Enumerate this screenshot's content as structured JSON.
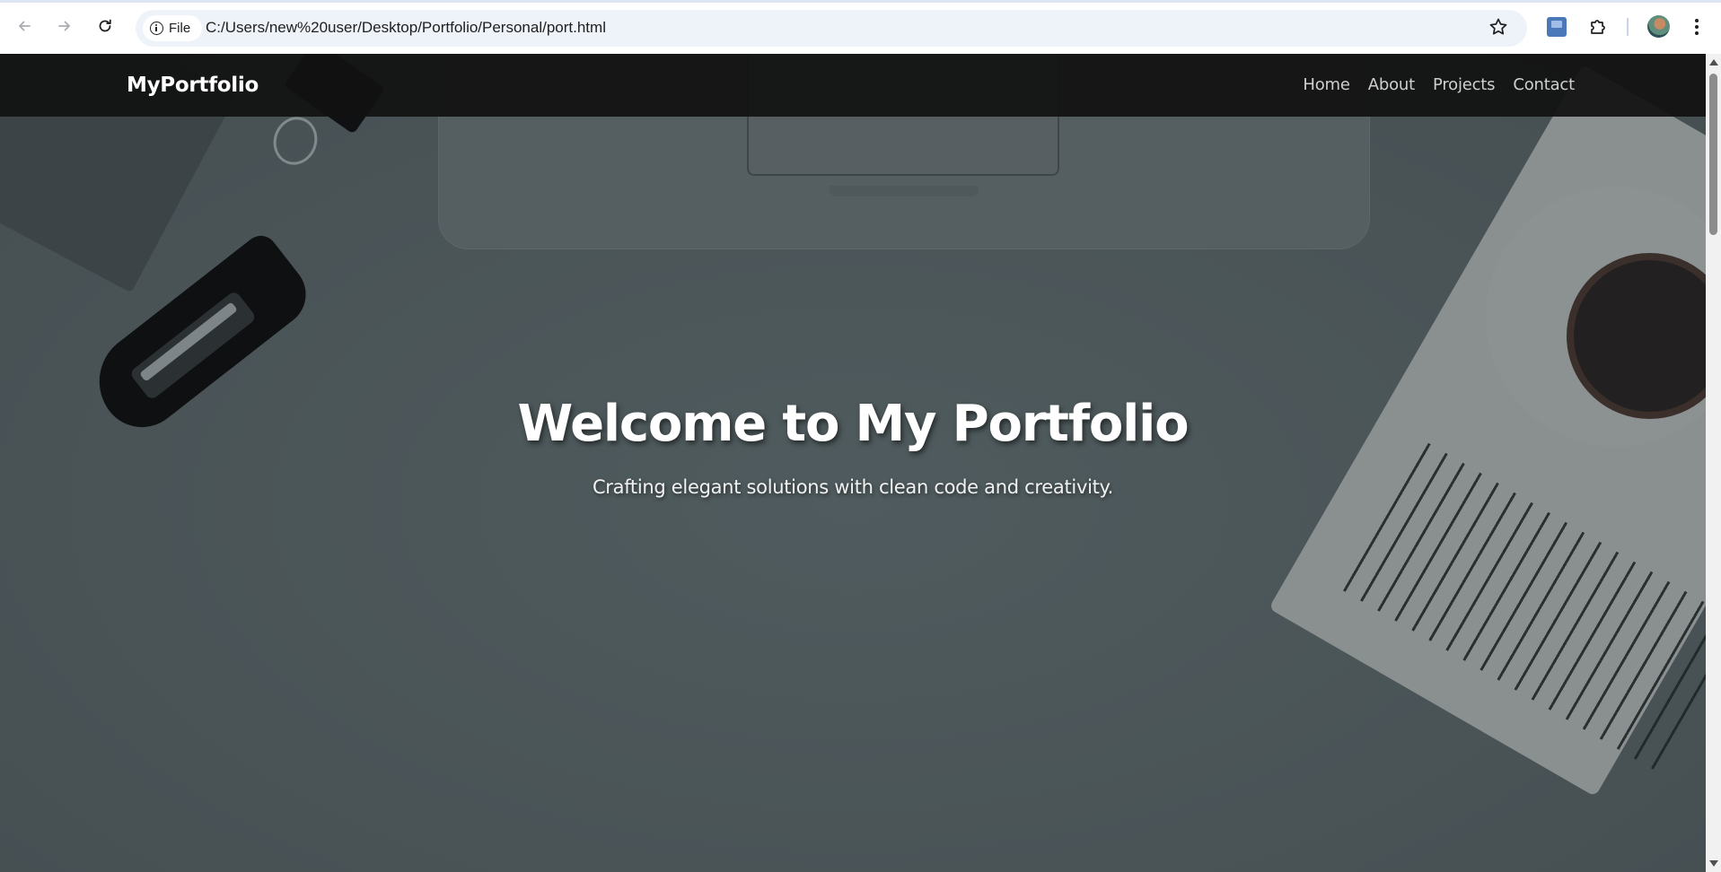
{
  "browser": {
    "site_chip_label": "File",
    "url": "C:/Users/new%20user/Desktop/Portfolio/Personal/port.html",
    "icons": [
      "back-icon",
      "forward-icon",
      "reload-icon",
      "info-icon",
      "bookmark-star-icon",
      "extension-app-icon",
      "extensions-puzzle-icon",
      "profile-avatar",
      "more-menu-icon"
    ]
  },
  "site": {
    "brand": "MyPortfolio",
    "nav": [
      "Home",
      "About",
      "Projects",
      "Contact"
    ],
    "hero": {
      "title": "Welcome to My Portfolio",
      "subtitle": "Crafting elegant solutions with clean code and creativity."
    }
  },
  "colors": {
    "header_bg": "#111111",
    "hero_overlay": "#4a5457",
    "text_primary": "#ffffff",
    "nav_link": "#cfcfcf"
  }
}
